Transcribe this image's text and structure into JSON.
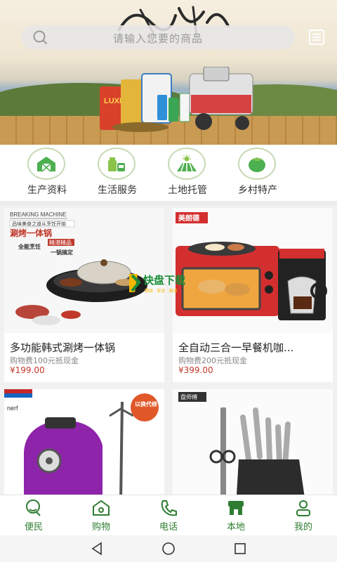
{
  "search": {
    "placeholder": "请输入您要的商品"
  },
  "categories": [
    {
      "label": "生产资料",
      "icon": "barn-icon"
    },
    {
      "label": "生活服务",
      "icon": "groceries-icon"
    },
    {
      "label": "土地托管",
      "icon": "farmland-icon"
    },
    {
      "label": "乡村特产",
      "icon": "tomato-icon"
    }
  ],
  "products": [
    {
      "title": "多功能韩式涮烤一体锅",
      "note": "购物费100元抵现金",
      "price": "¥199.00",
      "img_texts": [
        "BREAKING MACHINE",
        "品味美食之道从烹饪开始",
        "涮烤一体锅",
        "精湛精品",
        "全能烹饪",
        "一锅搞定"
      ]
    },
    {
      "title": "全自动三合一早餐机咖...",
      "note": "购物费200元抵现金",
      "price": "¥399.00",
      "img_texts": [
        "美朗德"
      ]
    },
    {
      "title": "",
      "note": "",
      "price": "",
      "img_texts": [
        "nerf",
        "以换代修"
      ]
    },
    {
      "title": "",
      "note": "",
      "price": "",
      "img_texts": [
        "盘师傅"
      ]
    }
  ],
  "watermark": {
    "main": "快盘下载",
    "sub": "精品 · 安全 · 高速"
  },
  "banner": {
    "sack_label": "LUXI"
  },
  "nav": [
    {
      "label": "便民",
      "icon": "convenience-icon"
    },
    {
      "label": "购物",
      "icon": "shop-icon"
    },
    {
      "label": "电话",
      "icon": "phone-icon"
    },
    {
      "label": "本地",
      "icon": "local-store-icon"
    },
    {
      "label": "我的",
      "icon": "profile-icon"
    }
  ],
  "colors": {
    "accent": "#2e7d32",
    "price": "#c0392b"
  }
}
